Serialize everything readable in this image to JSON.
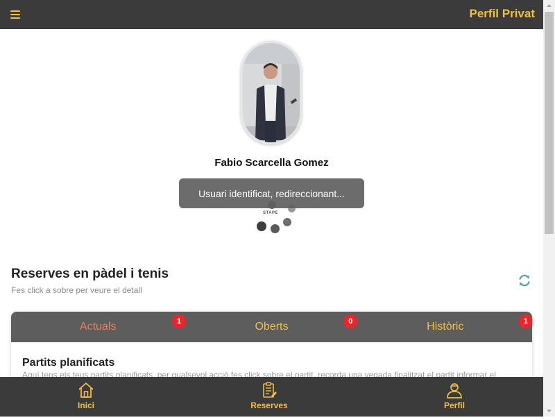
{
  "header": {
    "title": "Perfil Privat",
    "menu_icon": "hamburger-icon",
    "accent": "#f2be45",
    "bg": "#3b3b3b"
  },
  "profile": {
    "name": "Fabio Scarcella Gomez"
  },
  "toast": {
    "message": "Usuari identificat, redireccionant..."
  },
  "loader": {
    "logo_text": "STAPE"
  },
  "reservations": {
    "title": "Reserves en pàdel i tenis",
    "subtitle": "Fes click a sobre per veure el detall",
    "refresh_icon": "refresh-icon",
    "tabs": [
      {
        "label": "Actuals",
        "count": "1",
        "active": true
      },
      {
        "label": "Oberts",
        "count": "0",
        "active": false
      },
      {
        "label": "Històric",
        "count": "1",
        "active": false
      }
    ],
    "panel": {
      "title": "Partits planificats",
      "description": "Aquí tens els teus partits planificats, per qualsevol acció fes click sobre el partit, recorda una vegada finalitzat el partit informar el"
    }
  },
  "bottom_nav": [
    {
      "label": "Inici",
      "icon": "home-icon"
    },
    {
      "label": "Reserves",
      "icon": "clipboard-icon"
    },
    {
      "label": "Perfil",
      "icon": "user-icon"
    }
  ],
  "colors": {
    "active_tab": "#f47a52",
    "badge": "#e8262b",
    "tab_bar": "#5d5d5d",
    "refresh": "#5aa5a0"
  }
}
